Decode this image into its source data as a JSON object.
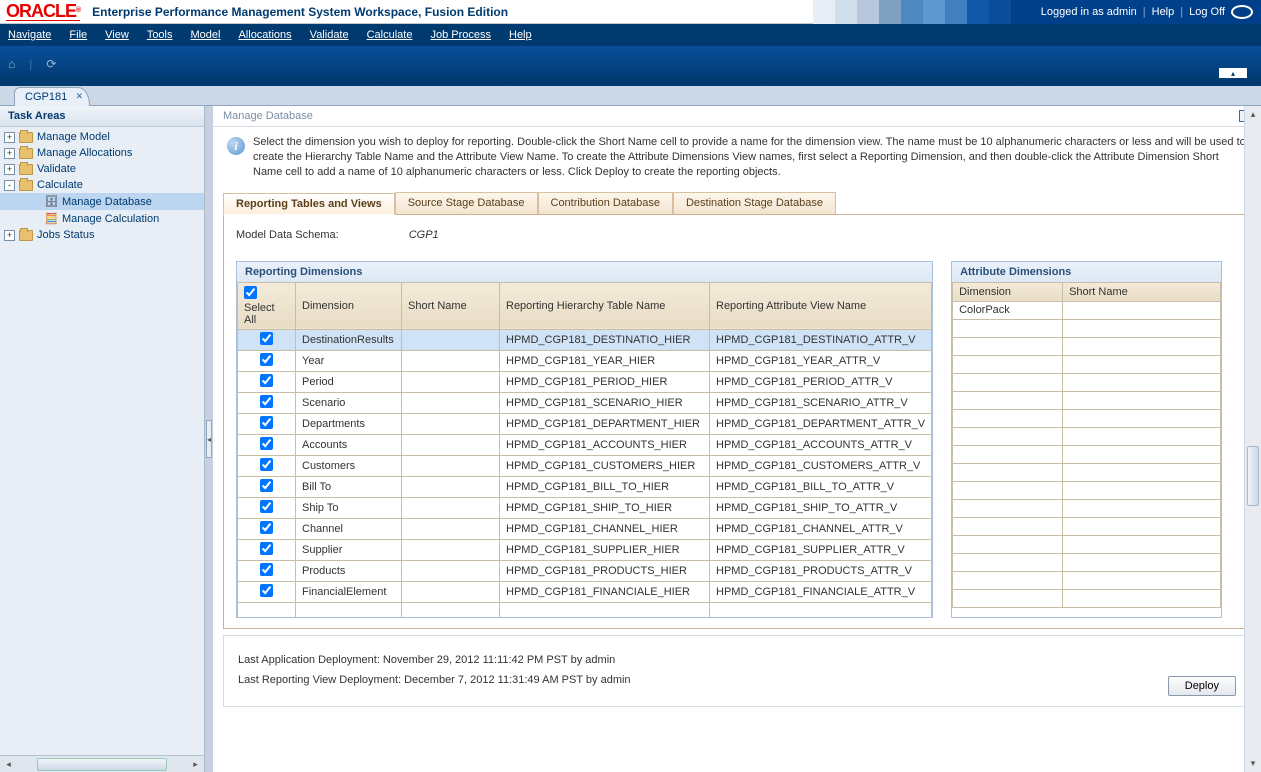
{
  "header": {
    "logo_text": "ORACLE",
    "app_title": "Enterprise Performance Management System Workspace, Fusion Edition",
    "logged_in_text": "Logged in as admin",
    "help": "Help",
    "logoff": "Log Off"
  },
  "menubar": [
    "Navigate",
    "File",
    "View",
    "Tools",
    "Model",
    "Allocations",
    "Validate",
    "Calculate",
    "Job Process",
    "Help"
  ],
  "app_tab": {
    "label": "CGP181"
  },
  "sidebar": {
    "title": "Task Areas",
    "nodes": [
      {
        "toggle": "+",
        "icon": "folder",
        "label": "Manage Model"
      },
      {
        "toggle": "+",
        "icon": "folder",
        "label": "Manage Allocations"
      },
      {
        "toggle": "+",
        "icon": "folder",
        "label": "Validate"
      },
      {
        "toggle": "-",
        "icon": "folder",
        "label": "Calculate"
      },
      {
        "toggle": " ",
        "icon": "db",
        "label": "Manage Database",
        "indent": 1,
        "selected": true
      },
      {
        "toggle": " ",
        "icon": "calc",
        "label": "Manage Calculation",
        "indent": 1
      },
      {
        "toggle": "+",
        "icon": "folder",
        "label": "Jobs Status"
      }
    ]
  },
  "content": {
    "crumb": "Manage Database",
    "info": "Select the dimension you wish to deploy for reporting.  Double-click the Short Name cell to provide a name for the dimension view.  The name must be 10 alphanumeric characters or less and will be used to create the Hierarchy Table Name and the Attribute View Name. To create the Attribute Dimensions View names, first select a Reporting Dimension, and then double-click the Attribute Dimension Short Name cell to add a name of 10 alphanumeric characters or less.  Click Deploy to create the reporting objects.",
    "tabs": [
      "Reporting Tables and Views",
      "Source Stage Database",
      "Contribution Database",
      "Destination Stage Database"
    ],
    "schema_label": "Model Data Schema:",
    "schema_value": "CGP1",
    "grid1": {
      "title": "Reporting Dimensions",
      "cols": [
        "Select All",
        "Dimension",
        "Short Name",
        "Reporting Hierarchy Table Name",
        "Reporting Attribute View Name"
      ],
      "rows": [
        {
          "sel": true,
          "dim": "DestinationResults",
          "sn": "",
          "h": "HPMD_CGP181_DESTINATIO_HIER",
          "a": "HPMD_CGP181_DESTINATIO_ATTR_V",
          "hl": true
        },
        {
          "sel": true,
          "dim": "Year",
          "sn": "",
          "h": "HPMD_CGP181_YEAR_HIER",
          "a": "HPMD_CGP181_YEAR_ATTR_V"
        },
        {
          "sel": true,
          "dim": "Period",
          "sn": "",
          "h": "HPMD_CGP181_PERIOD_HIER",
          "a": "HPMD_CGP181_PERIOD_ATTR_V"
        },
        {
          "sel": true,
          "dim": "Scenario",
          "sn": "",
          "h": "HPMD_CGP181_SCENARIO_HIER",
          "a": "HPMD_CGP181_SCENARIO_ATTR_V"
        },
        {
          "sel": true,
          "dim": "Departments",
          "sn": "",
          "h": "HPMD_CGP181_DEPARTMENT_HIER",
          "a": "HPMD_CGP181_DEPARTMENT_ATTR_V"
        },
        {
          "sel": true,
          "dim": "Accounts",
          "sn": "",
          "h": "HPMD_CGP181_ACCOUNTS_HIER",
          "a": "HPMD_CGP181_ACCOUNTS_ATTR_V"
        },
        {
          "sel": true,
          "dim": "Customers",
          "sn": "",
          "h": "HPMD_CGP181_CUSTOMERS_HIER",
          "a": "HPMD_CGP181_CUSTOMERS_ATTR_V"
        },
        {
          "sel": true,
          "dim": "Bill To",
          "sn": "",
          "h": "HPMD_CGP181_BILL_TO_HIER",
          "a": "HPMD_CGP181_BILL_TO_ATTR_V"
        },
        {
          "sel": true,
          "dim": "Ship To",
          "sn": "",
          "h": "HPMD_CGP181_SHIP_TO_HIER",
          "a": "HPMD_CGP181_SHIP_TO_ATTR_V"
        },
        {
          "sel": true,
          "dim": "Channel",
          "sn": "",
          "h": "HPMD_CGP181_CHANNEL_HIER",
          "a": "HPMD_CGP181_CHANNEL_ATTR_V"
        },
        {
          "sel": true,
          "dim": "Supplier",
          "sn": "",
          "h": "HPMD_CGP181_SUPPLIER_HIER",
          "a": "HPMD_CGP181_SUPPLIER_ATTR_V"
        },
        {
          "sel": true,
          "dim": "Products",
          "sn": "",
          "h": "HPMD_CGP181_PRODUCTS_HIER",
          "a": "HPMD_CGP181_PRODUCTS_ATTR_V"
        },
        {
          "sel": true,
          "dim": "FinancialElement",
          "sn": "",
          "h": "HPMD_CGP181_FINANCIALE_HIER",
          "a": "HPMD_CGP181_FINANCIALE_ATTR_V"
        }
      ]
    },
    "grid2": {
      "title": "Attribute Dimensions",
      "cols": [
        "Dimension",
        "Short Name"
      ],
      "rows": [
        {
          "dim": "ColorPack",
          "sn": ""
        }
      ]
    },
    "last_app_deploy": "Last Application Deployment: November 29, 2012 11:11:42 PM PST by admin",
    "last_view_deploy": "Last Reporting View Deployment: December 7, 2012 11:31:49 AM PST by admin",
    "deploy_btn": "Deploy"
  }
}
